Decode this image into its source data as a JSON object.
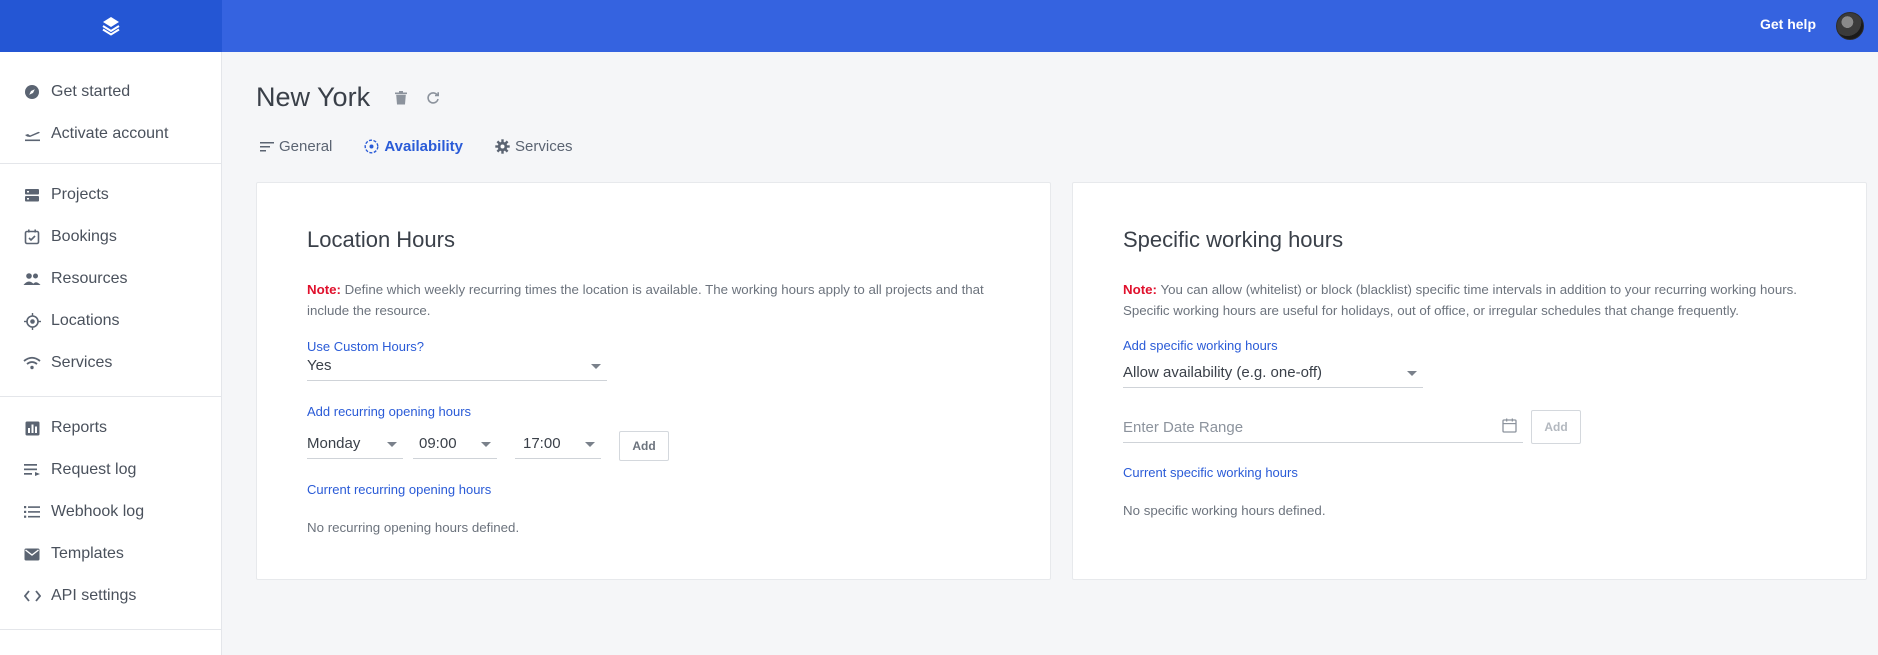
{
  "sidebar": {
    "groups": [
      [
        {
          "label": "Get started",
          "icon": "compass-icon"
        },
        {
          "label": "Activate account",
          "icon": "plane-takeoff-icon"
        }
      ],
      [
        {
          "label": "Projects",
          "icon": "projects-icon"
        },
        {
          "label": "Bookings",
          "icon": "calendar-check-icon"
        },
        {
          "label": "Resources",
          "icon": "people-icon"
        },
        {
          "label": "Locations",
          "icon": "location-target-icon"
        },
        {
          "label": "Services",
          "icon": "wifi-icon"
        }
      ],
      [
        {
          "label": "Reports",
          "icon": "bar-chart-icon"
        },
        {
          "label": "Request log",
          "icon": "request-list-icon"
        },
        {
          "label": "Webhook log",
          "icon": "list-icon"
        },
        {
          "label": "Templates",
          "icon": "envelope-icon"
        },
        {
          "label": "API settings",
          "icon": "code-icon"
        }
      ]
    ]
  },
  "topbar": {
    "help": "Get help"
  },
  "page": {
    "title": "New York",
    "tabs": [
      {
        "label": "General",
        "icon": "lines-icon",
        "active": false
      },
      {
        "label": "Availability",
        "icon": "clock-icon",
        "active": true
      },
      {
        "label": "Services",
        "icon": "gear-icon",
        "active": false
      }
    ]
  },
  "location_hours": {
    "title": "Location Hours",
    "note_label": "Note:",
    "note_text": " Define which weekly recurring times the location is available. The working hours apply to all projects and that include the resource.",
    "custom_label": "Use Custom Hours?",
    "custom_value": "Yes",
    "recurring_label": "Add recurring opening hours",
    "day_value": "Monday",
    "start_value": "09:00",
    "end_value": "17:00",
    "add_label": "Add",
    "current_label": "Current recurring opening hours",
    "empty": "No recurring opening hours defined."
  },
  "specific_hours": {
    "title": "Specific working hours",
    "note_label": "Note:",
    "note_text": " You can allow (whitelist) or block (blacklist) specific time intervals in addition to your recurring working hours. Specific working hours are useful for holidays, out of office, or irregular schedules that change frequently.",
    "add_label_text": "Add specific working hours",
    "type_value": "Allow availability (e.g. one-off)",
    "date_placeholder": "Enter Date Range",
    "add_label": "Add",
    "current_label": "Current specific working hours",
    "empty": "No specific working hours defined."
  }
}
